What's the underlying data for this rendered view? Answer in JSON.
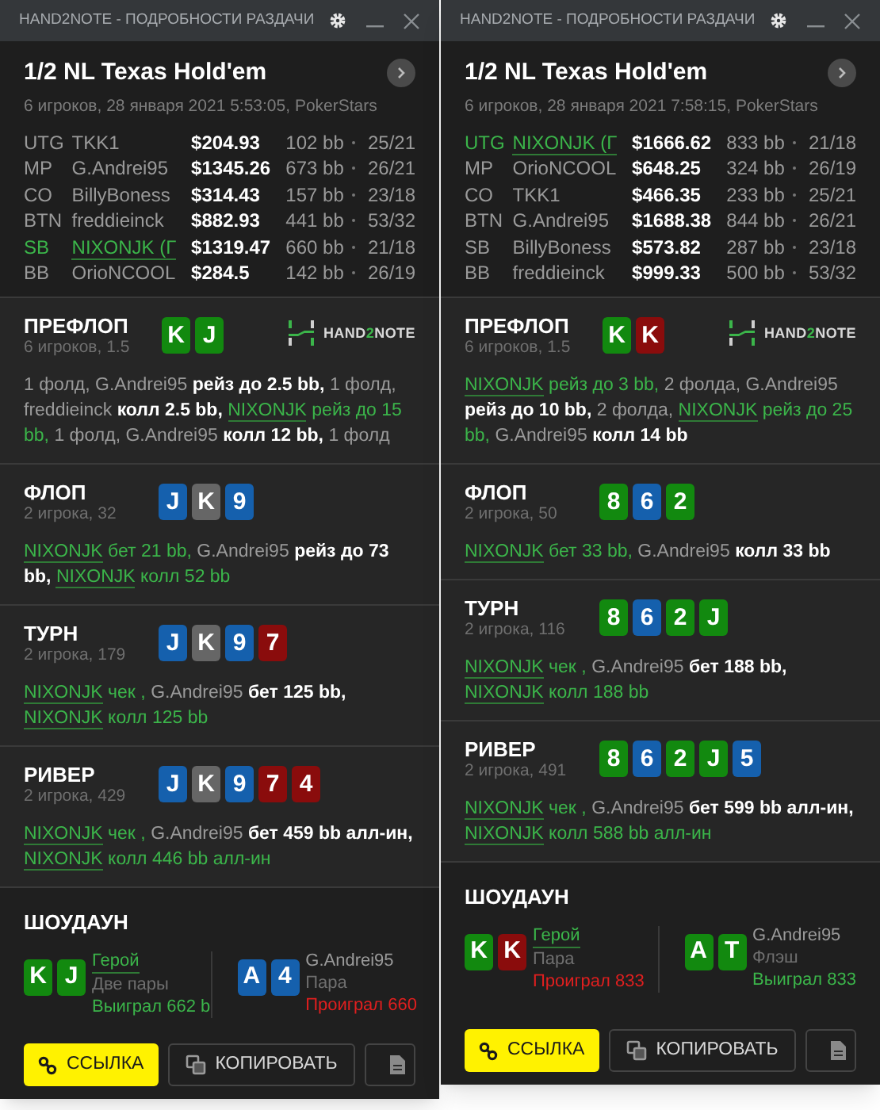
{
  "windows": [
    {
      "title": "HAND2NOTE - ПОДРОБНОСТИ РАЗДАЧИ",
      "game": "1/2 NL Texas Hold'em",
      "info": "6 игроков, 28 января 2021 5:53:05, PokerStars",
      "players": [
        {
          "position": "UTG",
          "name": "TKK1",
          "stack": "$204.93",
          "bb": "102 bb",
          "stats": "25/21",
          "hero": false
        },
        {
          "position": "MP",
          "name": "G.Andrei95",
          "stack": "$1345.26",
          "bb": "673 bb",
          "stats": "26/21",
          "hero": false
        },
        {
          "position": "CO",
          "name": "BillyBoness",
          "stack": "$314.43",
          "bb": "157 bb",
          "stats": "23/18",
          "hero": false
        },
        {
          "position": "BTN",
          "name": "freddieinck",
          "stack": "$882.93",
          "bb": "441 bb",
          "stats": "53/32",
          "hero": false
        },
        {
          "position": "SB",
          "name": "NIXONJK (Г",
          "stack": "$1319.47",
          "bb": "660 bb",
          "stats": "21/18",
          "hero": true
        },
        {
          "position": "BB",
          "name": "OrioNCOOL",
          "stack": "$284.5",
          "bb": "142 bb",
          "stats": "26/19",
          "hero": false
        }
      ],
      "streets": [
        {
          "name": "ПРЕФЛОП",
          "info": "6 игроков, 1.5",
          "logo": [
            "HAND",
            "2",
            "NOTE"
          ],
          "cards": [
            {
              "rank": "K",
              "color": "#12890f"
            },
            {
              "rank": "J",
              "color": "#12890f"
            }
          ],
          "actions": [
            {
              "text": "1 фолд,",
              "kind": "muted"
            },
            {
              "text": "G.Andrei95",
              "kind": "muted"
            },
            {
              "text": "рейз до 2.5 bb,",
              "kind": "action"
            },
            {
              "text": "1 фолд,",
              "kind": "muted"
            },
            {
              "text": "freddieinck",
              "kind": "muted"
            },
            {
              "text": "колл 2.5 bb,",
              "kind": "action"
            },
            {
              "text": "NIXONJK",
              "kind": "hero"
            },
            {
              "text": "рейз до 15 bb,",
              "kind": "hero_action"
            },
            {
              "text": "1 фолд,",
              "kind": "muted"
            },
            {
              "text": "G.Andrei95",
              "kind": "muted"
            },
            {
              "text": "колл 12 bb,",
              "kind": "action"
            },
            {
              "text": "1 фолд",
              "kind": "muted"
            }
          ]
        },
        {
          "name": "ФЛОП",
          "info": "2 игрока, 32",
          "cards": [
            {
              "rank": "J",
              "color": "#1560ad"
            },
            {
              "rank": "K",
              "color": "#666666"
            },
            {
              "rank": "9",
              "color": "#1560ad"
            }
          ],
          "actions": [
            {
              "text": "NIXONJK",
              "kind": "hero"
            },
            {
              "text": "бет 21 bb,",
              "kind": "hero_action"
            },
            {
              "text": "G.Andrei95",
              "kind": "muted"
            },
            {
              "text": "рейз до 73 bb,",
              "kind": "action"
            },
            {
              "text": "NIXONJK",
              "kind": "hero"
            },
            {
              "text": "колл 52 bb",
              "kind": "hero_action"
            }
          ]
        },
        {
          "name": "ТУРН",
          "info": "2 игрока, 179",
          "cards": [
            {
              "rank": "J",
              "color": "#1560ad"
            },
            {
              "rank": "K",
              "color": "#666666"
            },
            {
              "rank": "9",
              "color": "#1560ad"
            },
            {
              "rank": "7",
              "color": "#8a0c0c"
            }
          ],
          "actions": [
            {
              "text": "NIXONJK",
              "kind": "hero"
            },
            {
              "text": "чек ,",
              "kind": "hero_action"
            },
            {
              "text": "G.Andrei95",
              "kind": "muted"
            },
            {
              "text": "бет 125 bb,",
              "kind": "action"
            },
            {
              "text": "NIXONJK",
              "kind": "hero"
            },
            {
              "text": "колл 125 bb",
              "kind": "hero_action"
            }
          ]
        },
        {
          "name": "РИВЕР",
          "info": "2 игрока, 429",
          "cards": [
            {
              "rank": "J",
              "color": "#1560ad"
            },
            {
              "rank": "K",
              "color": "#666666"
            },
            {
              "rank": "9",
              "color": "#1560ad"
            },
            {
              "rank": "7",
              "color": "#8a0c0c"
            },
            {
              "rank": "4",
              "color": "#8a0c0c"
            }
          ],
          "actions": [
            {
              "text": "NIXONJK",
              "kind": "hero"
            },
            {
              "text": "чек ,",
              "kind": "hero_action"
            },
            {
              "text": "G.Andrei95",
              "kind": "muted"
            },
            {
              "text": "бет 459 bb алл-ин,",
              "kind": "action"
            },
            {
              "text": "NIXONJK",
              "kind": "hero"
            },
            {
              "text": "колл 446 bb алл-ин",
              "kind": "hero_action"
            }
          ]
        }
      ],
      "showdown": {
        "title": "ШОУДАУН",
        "players": [
          {
            "cards": [
              {
                "rank": "K",
                "color": "#12890f"
              },
              {
                "rank": "J",
                "color": "#12890f"
              }
            ],
            "name": "Герой",
            "hand": "Две пары",
            "result": "Выиграл 662 b",
            "hero": true,
            "won": true
          },
          {
            "cards": [
              {
                "rank": "A",
                "color": "#1560ad"
              },
              {
                "rank": "4",
                "color": "#1560ad"
              }
            ],
            "name": "G.Andrei95",
            "hand": "Пара",
            "result": "Проиграл 660",
            "hero": false,
            "won": false
          }
        ]
      },
      "buttons": [
        {
          "kind": "link",
          "label": "ССЫЛКА"
        },
        {
          "kind": "copy",
          "label": "КОПИРОВАТЬ"
        },
        {
          "kind": "file"
        }
      ]
    },
    {
      "title": "HAND2NOTE - ПОДРОБНОСТИ РАЗДАЧИ",
      "game": "1/2 NL Texas Hold'em",
      "info": "6 игроков, 28 января 2021 7:58:15, PokerStars",
      "players": [
        {
          "position": "UTG",
          "name": "NIXONJK (Г",
          "stack": "$1666.62",
          "bb": "833 bb",
          "stats": "21/18",
          "hero": true
        },
        {
          "position": "MP",
          "name": "OrioNCOOL",
          "stack": "$648.25",
          "bb": "324 bb",
          "stats": "26/19",
          "hero": false
        },
        {
          "position": "CO",
          "name": "TKK1",
          "stack": "$466.35",
          "bb": "233 bb",
          "stats": "25/21",
          "hero": false
        },
        {
          "position": "BTN",
          "name": "G.Andrei95",
          "stack": "$1688.38",
          "bb": "844 bb",
          "stats": "26/21",
          "hero": false
        },
        {
          "position": "SB",
          "name": "BillyBoness",
          "stack": "$573.82",
          "bb": "287 bb",
          "stats": "23/18",
          "hero": false
        },
        {
          "position": "BB",
          "name": "freddieinck",
          "stack": "$999.33",
          "bb": "500 bb",
          "stats": "53/32",
          "hero": false
        }
      ],
      "streets": [
        {
          "name": "ПРЕФЛОП",
          "info": "6 игроков, 1.5",
          "logo": [
            "HAND",
            "2",
            "NOTE"
          ],
          "cards": [
            {
              "rank": "K",
              "color": "#12890f"
            },
            {
              "rank": "K",
              "color": "#8a0c0c"
            }
          ],
          "actions": [
            {
              "text": "NIXONJK",
              "kind": "hero"
            },
            {
              "text": "рейз до 3 bb,",
              "kind": "hero_action"
            },
            {
              "text": "2 фолда,",
              "kind": "muted"
            },
            {
              "text": "G.Andrei95",
              "kind": "muted"
            },
            {
              "text": "рейз до 10 bb,",
              "kind": "action"
            },
            {
              "text": "2 фолда,",
              "kind": "muted"
            },
            {
              "text": "NIXONJK",
              "kind": "hero"
            },
            {
              "text": "рейз до 25 bb,",
              "kind": "hero_action"
            },
            {
              "text": "G.Andrei95",
              "kind": "muted"
            },
            {
              "text": "колл 14 bb",
              "kind": "action"
            }
          ]
        },
        {
          "name": "ФЛОП",
          "info": "2 игрока, 50",
          "cards": [
            {
              "rank": "8",
              "color": "#12890f"
            },
            {
              "rank": "6",
              "color": "#1560ad"
            },
            {
              "rank": "2",
              "color": "#12890f"
            }
          ],
          "actions": [
            {
              "text": "NIXONJK",
              "kind": "hero"
            },
            {
              "text": "бет 33 bb,",
              "kind": "hero_action"
            },
            {
              "text": "G.Andrei95",
              "kind": "muted"
            },
            {
              "text": "колл 33 bb",
              "kind": "action"
            }
          ]
        },
        {
          "name": "ТУРН",
          "info": "2 игрока, 116",
          "cards": [
            {
              "rank": "8",
              "color": "#12890f"
            },
            {
              "rank": "6",
              "color": "#1560ad"
            },
            {
              "rank": "2",
              "color": "#12890f"
            },
            {
              "rank": "J",
              "color": "#12890f"
            }
          ],
          "actions": [
            {
              "text": "NIXONJK",
              "kind": "hero"
            },
            {
              "text": "чек ,",
              "kind": "hero_action"
            },
            {
              "text": "G.Andrei95",
              "kind": "muted"
            },
            {
              "text": "бет 188 bb,",
              "kind": "action"
            },
            {
              "text": "NIXONJK",
              "kind": "hero"
            },
            {
              "text": "колл 188 bb",
              "kind": "hero_action"
            }
          ]
        },
        {
          "name": "РИВЕР",
          "info": "2 игрока, 491",
          "cards": [
            {
              "rank": "8",
              "color": "#12890f"
            },
            {
              "rank": "6",
              "color": "#1560ad"
            },
            {
              "rank": "2",
              "color": "#12890f"
            },
            {
              "rank": "J",
              "color": "#12890f"
            },
            {
              "rank": "5",
              "color": "#1560ad"
            }
          ],
          "actions": [
            {
              "text": "NIXONJK",
              "kind": "hero"
            },
            {
              "text": "чек ,",
              "kind": "hero_action"
            },
            {
              "text": "G.Andrei95",
              "kind": "muted"
            },
            {
              "text": "бет 599 bb алл-ин,",
              "kind": "action"
            },
            {
              "text": "NIXONJK",
              "kind": "hero"
            },
            {
              "text": "колл 588 bb алл-ин",
              "kind": "hero_action"
            }
          ]
        }
      ],
      "showdown": {
        "title": "ШОУДАУН",
        "players": [
          {
            "cards": [
              {
                "rank": "K",
                "color": "#12890f"
              },
              {
                "rank": "K",
                "color": "#8a0c0c"
              }
            ],
            "name": "Герой",
            "hand": "Пара",
            "result": "Проиграл 833",
            "hero": true,
            "won": false
          },
          {
            "cards": [
              {
                "rank": "A",
                "color": "#12890f"
              },
              {
                "rank": "T",
                "color": "#12890f"
              }
            ],
            "name": "G.Andrei95",
            "hand": "Флэш",
            "result": "Выиграл 833",
            "hero": false,
            "won": true
          }
        ]
      },
      "buttons": [
        {
          "kind": "link",
          "label": "ССЫЛКА"
        },
        {
          "kind": "copy",
          "label": "КОПИРОВАТЬ"
        },
        {
          "kind": "file"
        }
      ]
    }
  ]
}
